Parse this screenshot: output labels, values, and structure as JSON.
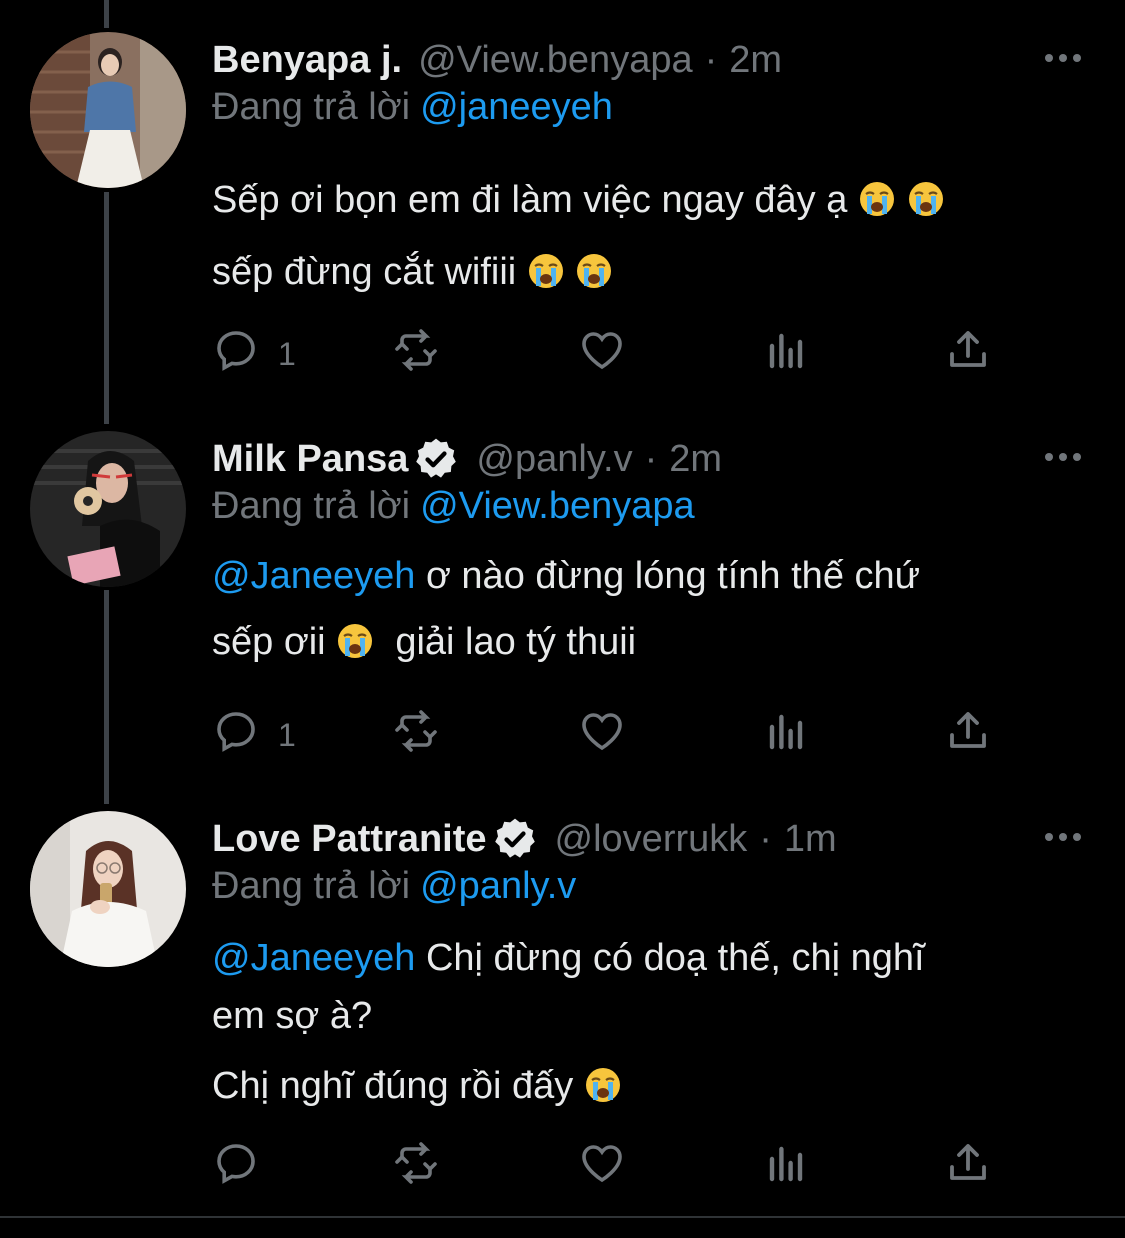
{
  "colors": {
    "background": "#000000",
    "primary_text": "#e7e9ea",
    "secondary_text": "#71767b",
    "accent": "#1d9bf0",
    "thread_line": "#3d4248"
  },
  "icons": {
    "reply": "speech-bubble-icon",
    "retweet": "retweet-arrows-icon",
    "like": "heart-icon",
    "views": "bar-chart-icon",
    "share": "share-upload-icon",
    "more": "ellipsis-icon",
    "verified": "verified-badge-icon",
    "emoji": "loudly-crying-face-emoji"
  },
  "tweets": [
    {
      "name": "Benyapa j.",
      "verified": false,
      "handle": "@View.benyapa",
      "separator": "·",
      "time": "2m",
      "reply_prefix": "Đang trả lời",
      "reply_to": "@janeeyeh",
      "lines": [
        {
          "text": "Sếp ơi bọn em đi làm việc ngay đây ạ",
          "emoji_count": 2
        },
        {
          "text": "sếp đừng cắt wifiii",
          "emoji_count": 2
        }
      ],
      "reply_count": "1"
    },
    {
      "name": "Milk Pansa",
      "verified": true,
      "handle": "@panly.v",
      "separator": "·",
      "time": "2m",
      "reply_prefix": "Đang trả lời",
      "reply_to": "@View.benyapa",
      "lines": [
        {
          "mention": "@Janeeyeh",
          "text": " ơ nào đừng lóng tính thế chứ"
        },
        {
          "text": "sếp ơii",
          "emoji_count": 1,
          "after": "  giải lao tý thuii"
        }
      ],
      "reply_count": "1"
    },
    {
      "name": "Love Pattranite",
      "verified": true,
      "handle": "@loverrukk",
      "separator": "·",
      "time": "1m",
      "reply_prefix": "Đang trả lời",
      "reply_to": "@panly.v",
      "lines": [
        {
          "mention": "@Janeeyeh",
          "text": " Chị đừng có doạ thế, chị nghĩ"
        },
        {
          "text": "em sợ à?"
        },
        {
          "text": "Chị nghĩ đúng rồi đấy",
          "emoji_count": 1
        }
      ],
      "reply_count": ""
    }
  ]
}
